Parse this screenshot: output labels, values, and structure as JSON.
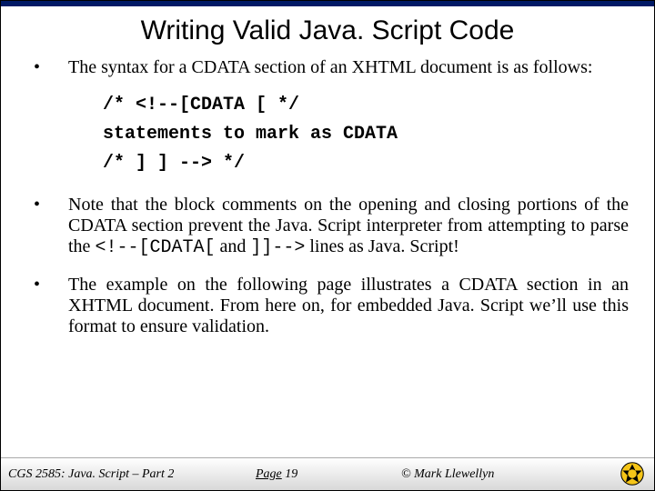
{
  "title": "Writing Valid Java. Script Code",
  "bullets": {
    "b1": "The syntax for a CDATA section of an XHTML document is as follows:",
    "code": {
      "l1": "/*  <!--[CDATA [    */",
      "l2": "    statements to mark as CDATA",
      "l3": "/*  ] ] -->    */"
    },
    "b2_pre": "Note that the block comments on the opening and closing portions of the CDATA section prevent the Java. Script interpreter from attempting to parse the ",
    "b2_mono1": "<!--[CDATA[",
    "b2_mid": " and ",
    "b2_mono2": "]]-->",
    "b2_post": " lines as Java. Script!",
    "b3": "The example on the following page illustrates a CDATA section in an XHTML document.  From here on, for embedded Java. Script we’ll use this format to ensure validation."
  },
  "footer": {
    "course": "CGS 2585: Java. Script – Part 2",
    "page_label": "Page",
    "page_num": "19",
    "copyright": "© Mark Llewellyn"
  }
}
